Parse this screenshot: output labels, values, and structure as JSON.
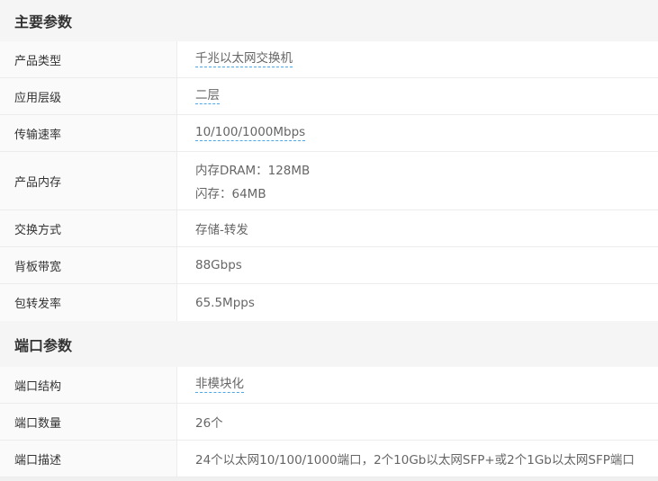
{
  "sections": [
    {
      "title": "主要参数",
      "rows": [
        {
          "label": "产品类型",
          "value": "千兆以太网交换机",
          "link": true
        },
        {
          "label": "应用层级",
          "value": "二层",
          "link": true
        },
        {
          "label": "传输速率",
          "value": "10/100/1000Mbps",
          "link": true
        },
        {
          "label": "产品内存",
          "lines": [
            "内存DRAM：128MB",
            "闪存：64MB"
          ]
        },
        {
          "label": "交换方式",
          "value": "存储-转发"
        },
        {
          "label": "背板带宽",
          "value": "88Gbps"
        },
        {
          "label": "包转发率",
          "value": "65.5Mpps"
        }
      ]
    },
    {
      "title": "端口参数",
      "rows": [
        {
          "label": "端口结构",
          "value": "非模块化",
          "link": true
        },
        {
          "label": "端口数量",
          "value": "26个"
        },
        {
          "label": "端口描述",
          "value": "24个以太网10/100/1000端口，2个10Gb以太网SFP+或2个1Gb以太网SFP端口"
        }
      ]
    }
  ]
}
